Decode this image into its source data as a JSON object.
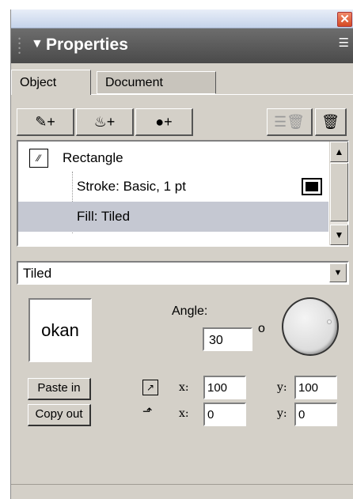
{
  "window": {
    "close_glyph": "✕"
  },
  "panel": {
    "collapse_glyph": "▼",
    "title": "Properties",
    "options_glyph": "☰"
  },
  "tabs": [
    {
      "label": "Object",
      "active": true
    },
    {
      "label": "Document",
      "active": false
    }
  ],
  "toolbar": {
    "stroke_glyph": "✎+",
    "fill_glyph": "♨+",
    "effect_glyph": "●+",
    "delete_glyph": "☰🗑",
    "delete_all_glyph": "🗑"
  },
  "attributes": {
    "items": [
      {
        "label": "Rectangle"
      },
      {
        "label": "Stroke: Basic, 1 pt"
      },
      {
        "label": "Fill: Tiled",
        "selected": true
      }
    ]
  },
  "fill_type": {
    "value": "Tiled"
  },
  "texture": {
    "preview_text": "okan"
  },
  "angle": {
    "label": "Angle:",
    "value": "30",
    "unit": "o"
  },
  "paste": {
    "label": "Paste in",
    "x_label": "x:",
    "x": "100",
    "y_label": "y:",
    "y": "100"
  },
  "copy": {
    "label": "Copy out",
    "x_label": "x:",
    "x": "0",
    "y_label": "y:",
    "y": "0"
  },
  "colors": {
    "header": "#555555",
    "panel": "#d4d0c8",
    "selection": "#c5c8d2",
    "close": "#d9532b"
  }
}
